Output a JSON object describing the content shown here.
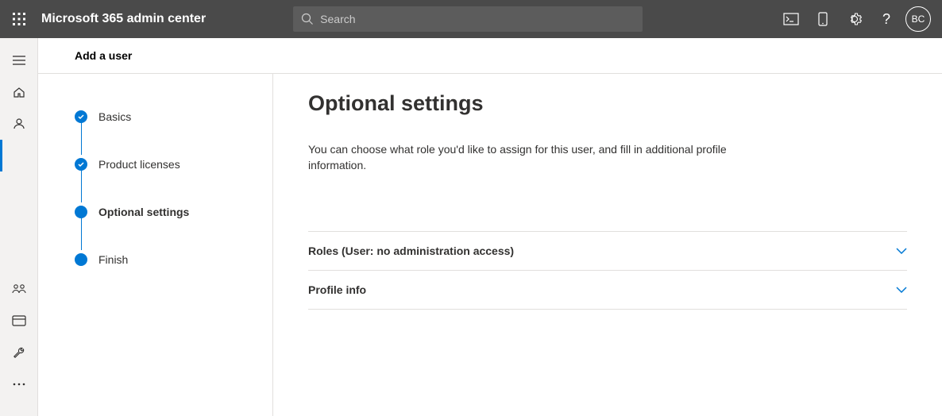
{
  "header": {
    "app_title": "Microsoft 365 admin center",
    "search_placeholder": "Search",
    "avatar_initials": "BC"
  },
  "panel": {
    "title": "Add a user"
  },
  "wizard": {
    "steps": [
      {
        "label": "Basics",
        "state": "done"
      },
      {
        "label": "Product licenses",
        "state": "done"
      },
      {
        "label": "Optional settings",
        "state": "current"
      },
      {
        "label": "Finish",
        "state": "upcoming"
      }
    ]
  },
  "content": {
    "title": "Optional settings",
    "description": "You can choose what role you'd like to assign for this user, and fill in additional profile information.",
    "sections": [
      {
        "label": "Roles (User: no administration access)"
      },
      {
        "label": "Profile info"
      }
    ]
  }
}
